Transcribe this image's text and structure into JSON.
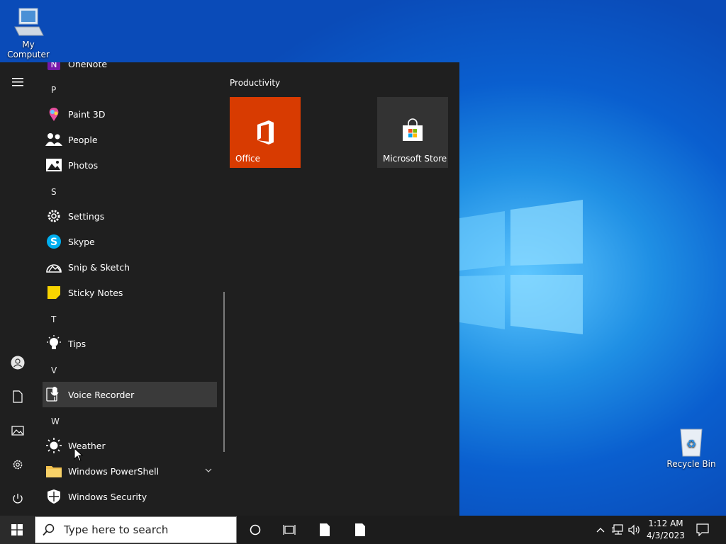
{
  "desktop": {
    "icons": [
      {
        "label": "My Computer"
      },
      {
        "label": "Recycle Bin"
      }
    ]
  },
  "start_menu": {
    "apps": [
      {
        "label": "OneNote",
        "icon": "onenote-icon"
      },
      {
        "letter": "P"
      },
      {
        "label": "Paint 3D",
        "icon": "paint3d-icon"
      },
      {
        "label": "People",
        "icon": "people-icon"
      },
      {
        "label": "Photos",
        "icon": "photos-icon"
      },
      {
        "letter": "S"
      },
      {
        "label": "Settings",
        "icon": "gear-icon"
      },
      {
        "label": "Skype",
        "icon": "skype-icon"
      },
      {
        "label": "Snip & Sketch",
        "icon": "snip-icon"
      },
      {
        "label": "Sticky Notes",
        "icon": "sticky-notes-icon"
      },
      {
        "letter": "T"
      },
      {
        "label": "Tips",
        "icon": "lightbulb-icon"
      },
      {
        "letter": "V"
      },
      {
        "label": "Voice Recorder",
        "icon": "microphone-icon",
        "highlighted": true
      },
      {
        "letter": "W"
      },
      {
        "label": "Weather",
        "icon": "sun-icon"
      },
      {
        "label": "Windows PowerShell",
        "icon": "folder-icon",
        "expandable": true
      },
      {
        "label": "Windows Security",
        "icon": "shield-icon"
      }
    ],
    "tiles_group": "Productivity",
    "tiles": [
      {
        "label": "Office",
        "color": "#d83b01"
      },
      {
        "label": "Microsoft Store",
        "color": "#333333"
      }
    ]
  },
  "taskbar": {
    "search_placeholder": "Type here to search",
    "time": "1:12 AM",
    "date": "4/3/2023"
  },
  "colors": {
    "start_bg": "#1f1f1f",
    "taskbar_bg": "#1c1c1c",
    "office_orange": "#d83b01",
    "highlight": "#3a3a3a"
  }
}
